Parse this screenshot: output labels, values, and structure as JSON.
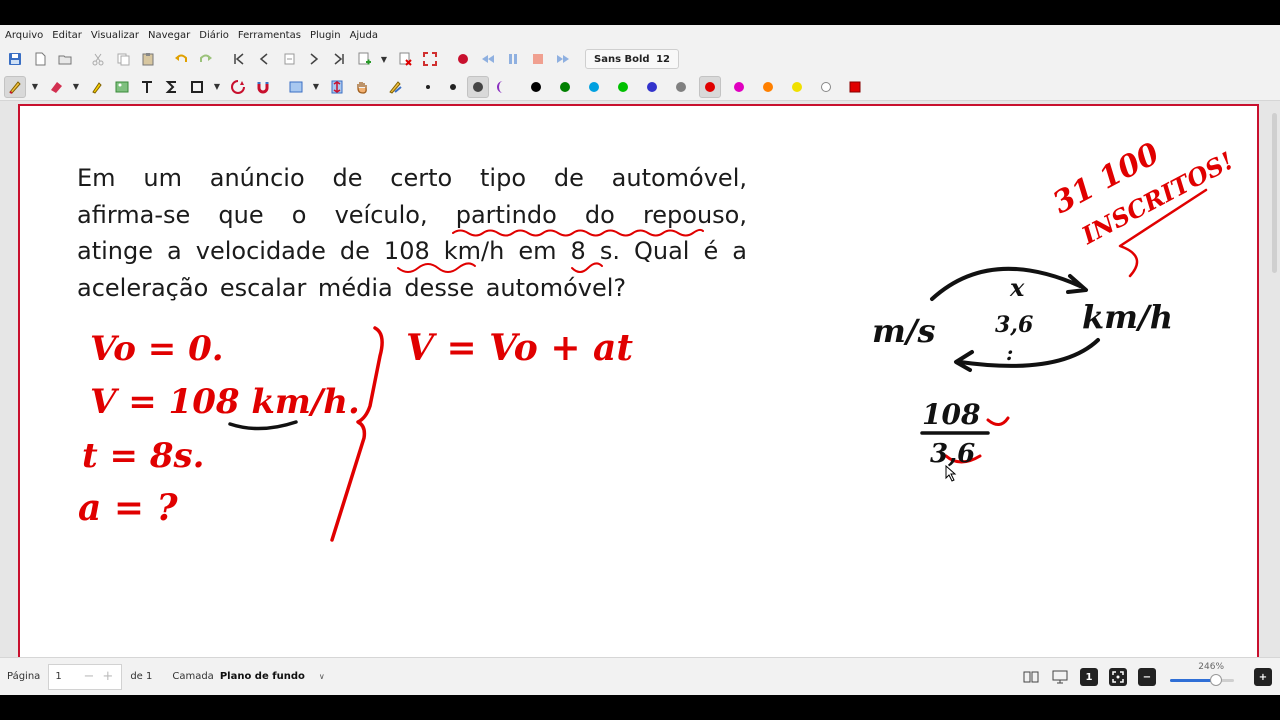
{
  "menu": [
    "Arquivo",
    "Editar",
    "Visualizar",
    "Navegar",
    "Diário",
    "Ferramentas",
    "Plugin",
    "Ajuda"
  ],
  "toolbar": {
    "font_name": "Sans Bold",
    "font_size": "12"
  },
  "colors": {
    "accent_red": "#c8102e",
    "palette": [
      "#000000",
      "#008000",
      "#00a0e0",
      "#00c000",
      "#3333cc",
      "#808080",
      "#e00000",
      "#e000c0",
      "#ff8000",
      "#f0e000",
      "#ffffff"
    ],
    "selected_palette": "#e00000"
  },
  "document": {
    "question_lines": [
      "Em um anúncio de certo tipo de automóvel,",
      "afirma-se que o veículo, partindo do repouso,",
      "atinge a velocidade de 108 km/h em 8 s. Qual é a",
      "aceleração escalar média desse automóvel?"
    ],
    "handwriting": {
      "given_v0": "Vo = 0.",
      "given_v": "V = 108 km/h.",
      "given_t": "t = 8s.",
      "given_a": "a = ?",
      "formula": "V = Vo + at",
      "conv_from": "m/s",
      "conv_to": "km/h",
      "conv_op_top": "x",
      "conv_factor": "3,6",
      "conv_op_bottom": ":",
      "frac_num": "108",
      "frac_den": "3,6",
      "banner_line1": "31 100",
      "banner_line2": "INSCRITOS!"
    }
  },
  "status": {
    "page_label": "Página",
    "page_value": "1",
    "of_label": "de 1",
    "layer_label": "Camada",
    "layer_value": "Plano de fundo",
    "zoom": "246%",
    "zoom_fraction": 0.72
  }
}
